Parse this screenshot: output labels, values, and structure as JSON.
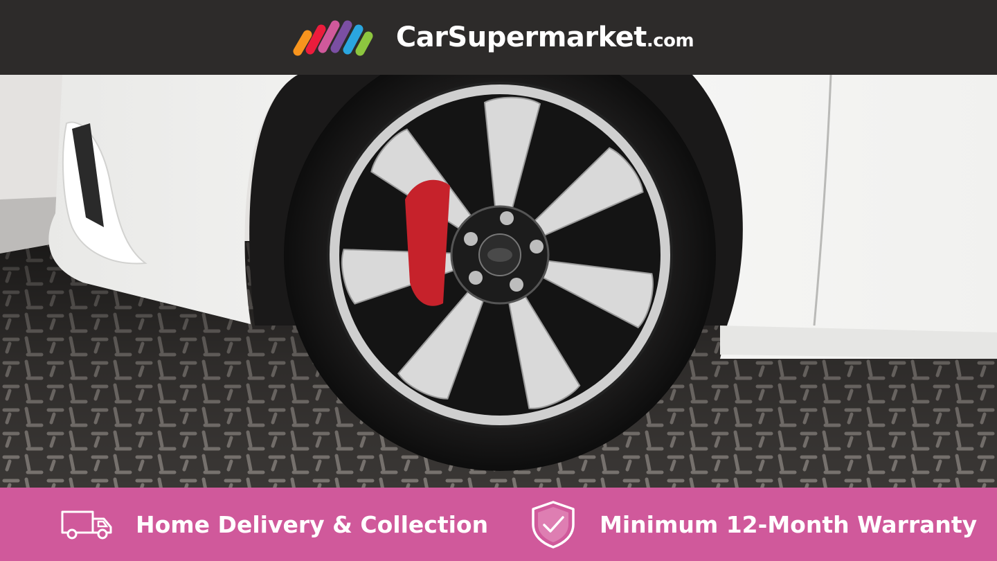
{
  "header": {
    "brand_name": "CarSupermarket",
    "brand_suffix": ".com",
    "logo_icon": "rainbow-stripes-logo",
    "logo_colors": [
      "#f7941d",
      "#ec1c3c",
      "#d0599b",
      "#7b4fa3",
      "#2aa6df",
      "#8dc63f"
    ],
    "background": "#2d2b2a"
  },
  "photo": {
    "subject": "car-wheel-photo"
  },
  "footer": {
    "background": "#d0599b",
    "features": [
      {
        "icon": "delivery-truck-icon",
        "label": "Home Delivery & Collection"
      },
      {
        "icon": "shield-check-icon",
        "label": "Minimum 12-Month Warranty"
      }
    ]
  }
}
